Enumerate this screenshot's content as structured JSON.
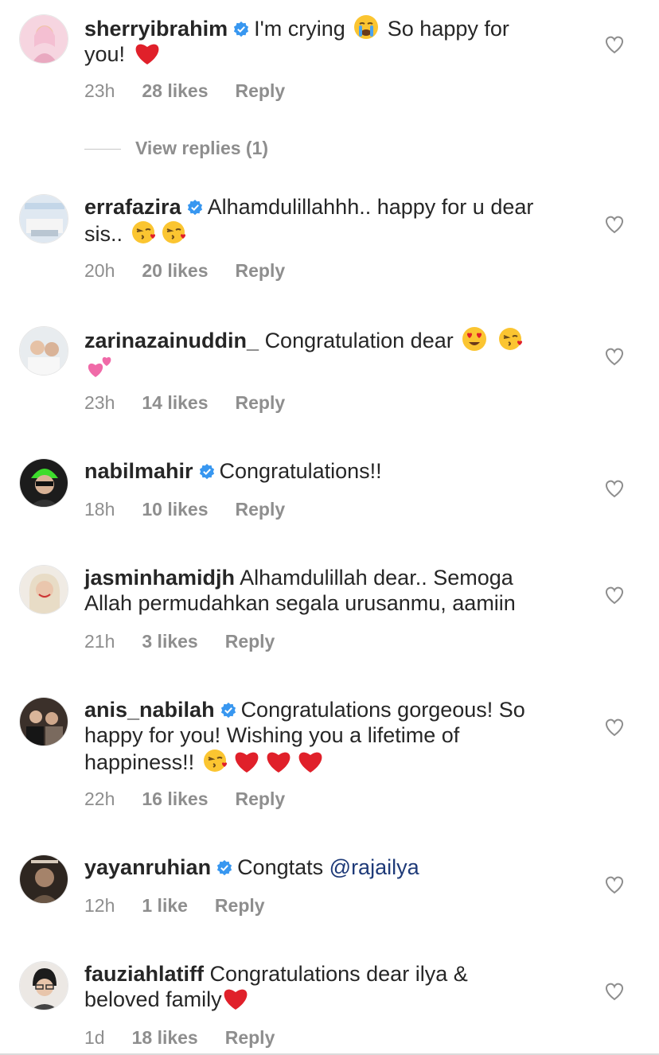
{
  "comments": [
    {
      "username": "sherryibrahim",
      "verified": true,
      "line1": "I'm crying",
      "line1b": "So happy for",
      "line2": "you!",
      "time": "23h",
      "likes": "28 likes",
      "reply": "Reply",
      "avatar_color": "#f3c9d8"
    },
    {
      "username": "errafazira",
      "verified": true,
      "line1": "Alhamdulillahhh.. happy for u dear",
      "line2": "sis..",
      "time": "20h",
      "likes": "20 likes",
      "reply": "Reply",
      "avatar_color": "#c9d8e6"
    },
    {
      "username": "zarinazainuddin_",
      "verified": false,
      "line1": "Congratulation dear",
      "time": "23h",
      "likes": "14 likes",
      "reply": "Reply",
      "avatar_color": "#dfe4e8"
    },
    {
      "username": "nabilmahir",
      "verified": true,
      "line1": "Congratulations!!",
      "time": "18h",
      "likes": "10 likes",
      "reply": "Reply",
      "avatar_color": "#2a2a2a"
    },
    {
      "username": "jasminhamidjh",
      "verified": false,
      "line1": "Alhamdulillah dear.. Semoga",
      "line2": "Allah permudahkan segala urusanmu, aamiin",
      "time": "21h",
      "likes": "3 likes",
      "reply": "Reply",
      "avatar_color": "#e9d9c8"
    },
    {
      "username": "anis_nabilah",
      "verified": true,
      "line1": "Congratulations gorgeous! So",
      "line2": "happy for you! Wishing you a lifetime of",
      "line3": "happiness!!",
      "time": "22h",
      "likes": "16 likes",
      "reply": "Reply",
      "avatar_color": "#5a4a3e"
    },
    {
      "username": "yayanruhian",
      "verified": true,
      "line1": "Congtats",
      "mention": "@rajailya",
      "time": "12h",
      "likes": "1 like",
      "reply": "Reply",
      "avatar_color": "#3f3429"
    },
    {
      "username": "fauziahlatiff",
      "verified": false,
      "line1": "Congratulations dear ilya &",
      "line2": "beloved family",
      "time": "1d",
      "likes": "18 likes",
      "reply": "Reply",
      "avatar_color": "#d9d2cc"
    }
  ],
  "view_replies": "View replies (1)",
  "colors": {
    "verified": "#3897f0",
    "heart_red": "#e0202a",
    "meta_gray": "#8e8e8e",
    "mention": "#1e3a78"
  }
}
